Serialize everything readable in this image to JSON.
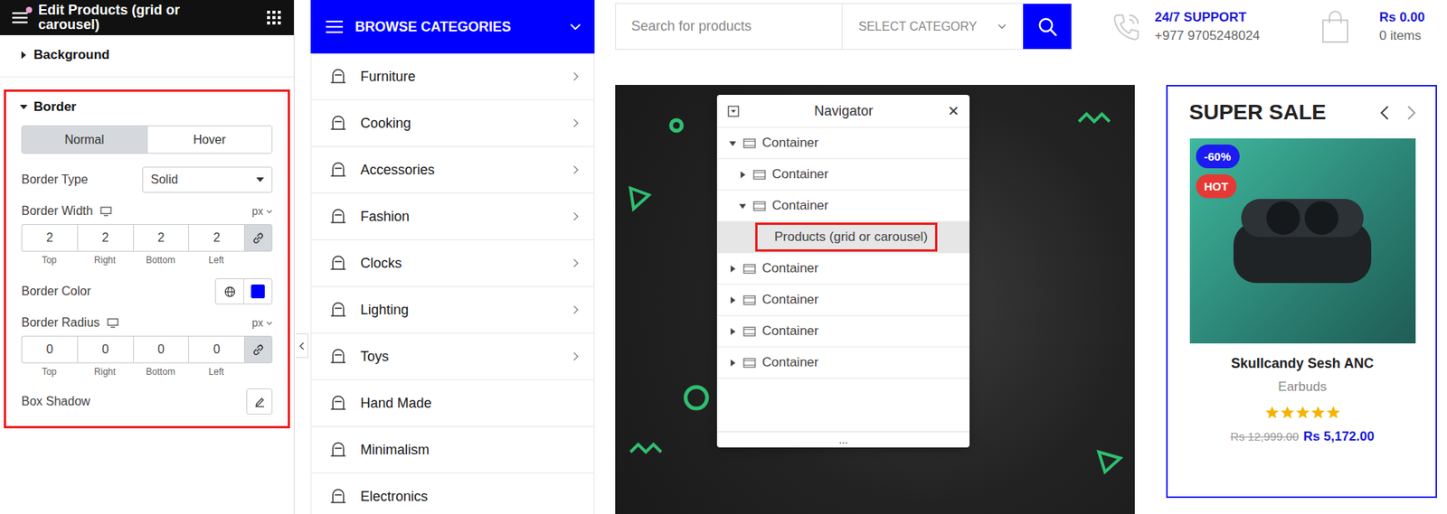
{
  "editor": {
    "title": "Edit Products (grid or carousel)",
    "background": {
      "label": "Background",
      "expanded": false
    },
    "border": {
      "label": "Border",
      "expanded": true,
      "highlighted": true,
      "state_tabs": [
        {
          "label": "Normal",
          "selected": true
        },
        {
          "label": "Hover",
          "selected": false
        }
      ],
      "border_type": {
        "label": "Border Type",
        "value": "Solid"
      },
      "border_width": {
        "label": "Border Width",
        "unit": "px",
        "values": [
          "2",
          "2",
          "2",
          "2"
        ],
        "linked": true
      },
      "border_color": {
        "label": "Border Color",
        "color": "#0000ff"
      },
      "border_radius": {
        "label": "Border Radius",
        "unit": "px",
        "values": [
          "0",
          "0",
          "0",
          "0"
        ],
        "linked": true
      },
      "side_labels": [
        "Top",
        "Right",
        "Bottom",
        "Left"
      ],
      "box_shadow": {
        "label": "Box Shadow"
      }
    }
  },
  "categories": {
    "title": "BROWSE CATEGORIES",
    "items": [
      {
        "label": "Furniture",
        "has_submenu": true
      },
      {
        "label": "Cooking",
        "has_submenu": true
      },
      {
        "label": "Accessories",
        "has_submenu": true
      },
      {
        "label": "Fashion",
        "has_submenu": true
      },
      {
        "label": "Clocks",
        "has_submenu": true
      },
      {
        "label": "Lighting",
        "has_submenu": true
      },
      {
        "label": "Toys",
        "has_submenu": true
      },
      {
        "label": "Hand Made",
        "has_submenu": false
      },
      {
        "label": "Minimalism",
        "has_submenu": false
      },
      {
        "label": "Electronics",
        "has_submenu": false
      }
    ]
  },
  "header": {
    "search_placeholder": "Search for products",
    "category_select": "SELECT CATEGORY",
    "support_title": "24/7 SUPPORT",
    "support_phone": "+977 9705248024",
    "cart_total": "Rs 0.00",
    "cart_items": "0 items"
  },
  "navigator": {
    "title": "Navigator",
    "close": "×",
    "footer": "...",
    "items": [
      {
        "label": "Container",
        "kind": "container",
        "depth": 0,
        "has_children": true,
        "expanded": true,
        "selected": false
      },
      {
        "label": "Container",
        "kind": "container",
        "depth": 1,
        "has_children": true,
        "expanded": false,
        "selected": false
      },
      {
        "label": "Container",
        "kind": "container",
        "depth": 1,
        "has_children": true,
        "expanded": true,
        "selected": false
      },
      {
        "label": "Products (grid or carousel)",
        "kind": "widget",
        "depth": 2,
        "has_children": false,
        "expanded": false,
        "selected": true
      },
      {
        "label": "Container",
        "kind": "container",
        "depth": 0,
        "has_children": true,
        "expanded": false,
        "selected": false
      },
      {
        "label": "Container",
        "kind": "container",
        "depth": 0,
        "has_children": true,
        "expanded": false,
        "selected": false
      },
      {
        "label": "Container",
        "kind": "container",
        "depth": 0,
        "has_children": true,
        "expanded": false,
        "selected": false
      },
      {
        "label": "Container",
        "kind": "container",
        "depth": 0,
        "has_children": true,
        "expanded": false,
        "selected": false
      }
    ]
  },
  "sale": {
    "title": "SUPER SALE",
    "selected": true,
    "product": {
      "badges": [
        {
          "label": "-60%",
          "color": "#1c1cf0"
        },
        {
          "label": "HOT",
          "color": "#e53935"
        }
      ],
      "name": "Skullcandy Sesh ANC",
      "category": "Earbuds",
      "stars": 5,
      "old_price": "Rs 12,999.00",
      "price": "Rs 5,172.00"
    }
  }
}
